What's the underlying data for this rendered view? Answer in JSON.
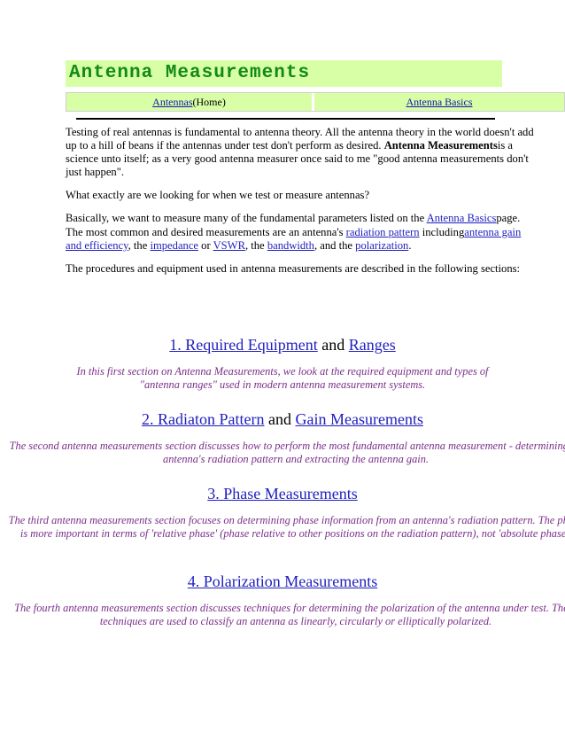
{
  "page": {
    "title": "Antenna Measurements",
    "background_color": "#ffffff",
    "banner_color": "#d9ffa6",
    "title_color": "#128a16",
    "link_color": "#1f1fbe",
    "italic_color": "#7a2f8a"
  },
  "nav": {
    "left": {
      "link_label": "Antennas",
      "suffix": " (Home)"
    },
    "right": {
      "link_label": "Antenna Basics"
    }
  },
  "intro": {
    "p1_part1": "Testing of real antennas is fundamental to antenna theory. All the antenna theory in the world doesn't add up to a hill of beans if the antennas under test don't perform as desired. ",
    "p1_bold": "Antenna Measurements",
    "p1_part2": "is a science unto itself; as a very good antenna measurer once said to me \"good antenna measurements don't just happen\".",
    "p2": "What exactly are we looking for when we test or measure antennas?",
    "p3_part1": "Basically, we want to measure many of the fundamental parameters listed on the ",
    "p3_link1": "Antenna Basics",
    "p3_part2": "page. The most common and desired measurements are an antenna's ",
    "p3_link2": "radiation pattern",
    "p3_part3": " including",
    "p3_link3": "antenna gain and efficiency",
    "p3_part4": ", the ",
    "p3_link4": "impedance",
    "p3_part5": " or ",
    "p3_link5": "VSWR",
    "p3_part6": ", the ",
    "p3_link6": "bandwidth",
    "p3_part7": ", and the ",
    "p3_link7": "polarization",
    "p3_part8": ".",
    "p4": "The procedures and equipment used in antenna measurements are described in the following sections:"
  },
  "sections": [
    {
      "number": "1.",
      "link1": "1. Required Equipment",
      "conj": " and ",
      "link2": "Ranges",
      "description": "In this first section on Antenna Measurements, we look at the required equipment and types of \"antenna ranges\" used in modern antenna measurement systems."
    },
    {
      "number": "2.",
      "link1": "2. Radiaton Pattern",
      "conj": " and ",
      "link2": "Gain Measurements",
      "description": "The second antenna measurements section discusses how to perform the most fundamental antenna measurement - determining an antenna's radiation pattern and extracting the antenna gain."
    },
    {
      "number": "3.",
      "link1": "3. Phase Measurements",
      "conj": "",
      "link2": "",
      "description": "The third antenna measurements section focuses on determining phase information from an antenna's radiation pattern. The phase is more important in terms of 'relative phase' (phase relative to other positions on the radiation pattern), not 'absolute phase'."
    },
    {
      "number": "4.",
      "link1": "4. Polarization Measurements",
      "conj": "",
      "link2": "",
      "description": "The fourth antenna measurements section discusses techniques for determining the polarization of the antenna under test. These techniques are used to classify an antenna as linearly, circularly or elliptically polarized."
    }
  ]
}
